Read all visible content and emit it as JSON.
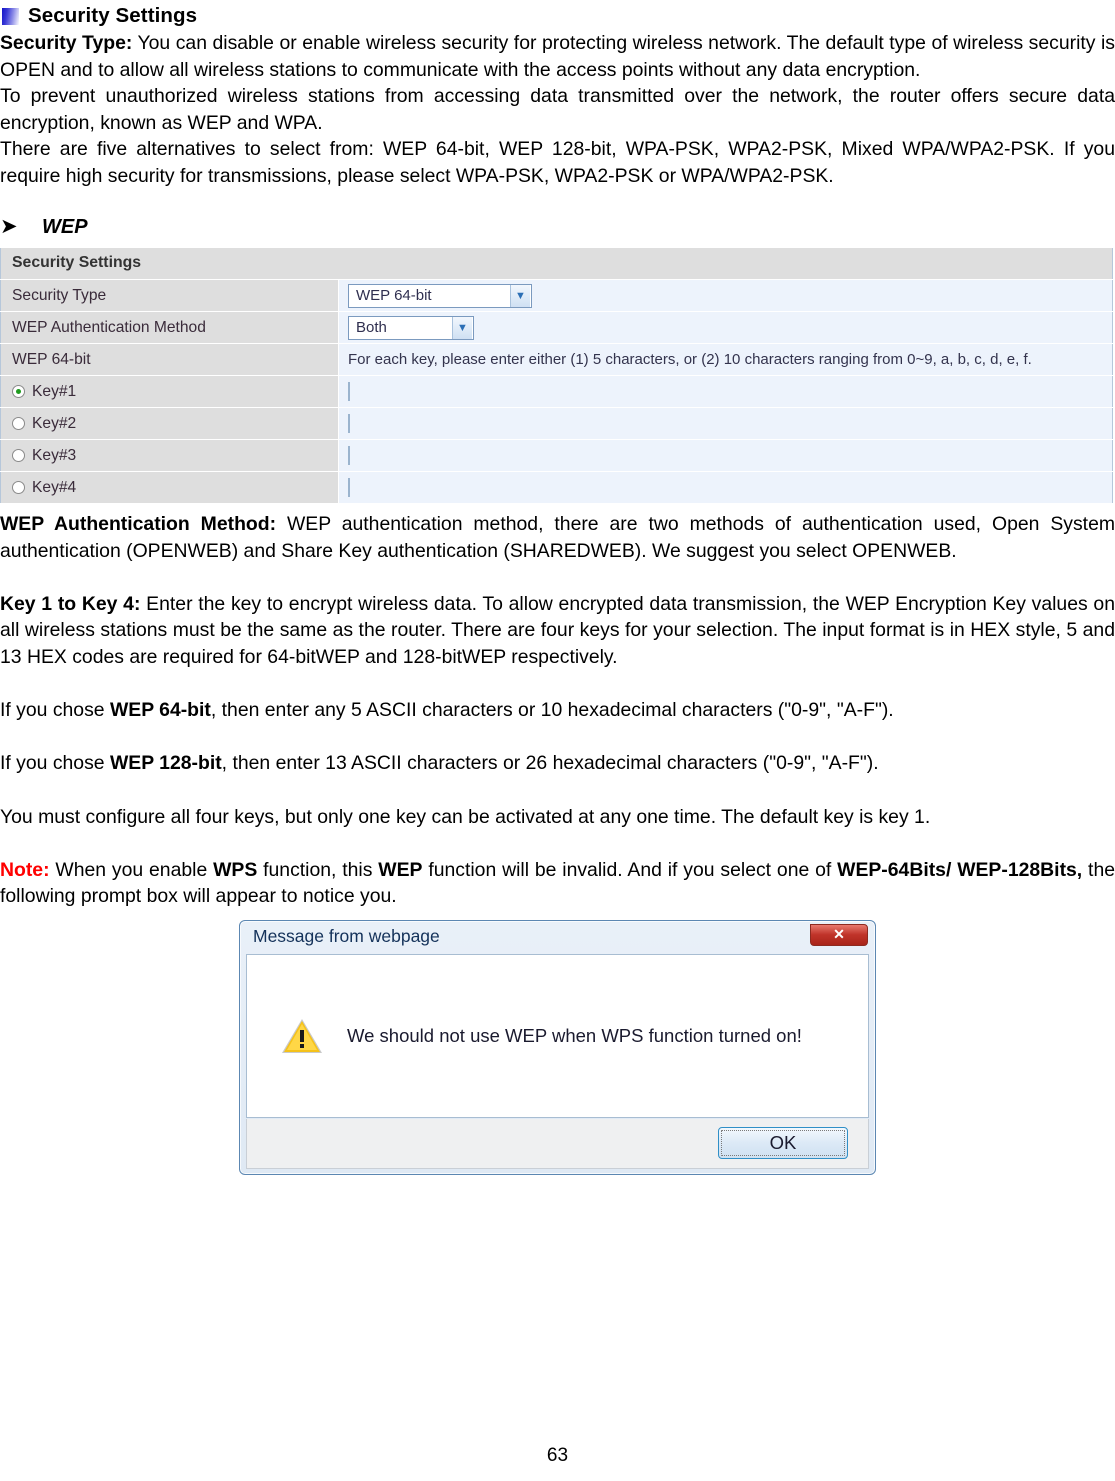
{
  "heading": {
    "title": "Security Settings",
    "bullet_icon": "blue-square-bullet-icon"
  },
  "paragraphs": {
    "security_type_label": "Security Type:",
    "security_type_body": " You can disable or enable wireless security for protecting wireless network. The default type of wireless security is OPEN and to allow all wireless stations to communicate with the access points without any data encryption.",
    "prevent_body": "To prevent unauthorized wireless stations from accessing data transmitted over the network, the router offers secure data encryption, known as WEP and WPA.",
    "alternatives_body": "There are five alternatives to select from: WEP 64-bit, WEP 128-bit, WPA-PSK, WPA2-PSK, Mixed WPA/WPA2-PSK. If you require high security for transmissions, please select WPA-PSK, WPA2-PSK or WPA/WPA2-PSK.",
    "wep_auth_label": "WEP Authentication Method:",
    "wep_auth_body": " WEP authentication method, there are two methods of authentication used, Open System authentication (OPENWEB) and Share Key authentication (SHAREDWEB). We suggest you select OPENWEB.",
    "key1to4_label": "Key 1 to Key 4:",
    "key1to4_body": " Enter the key to encrypt wireless data. To allow encrypted data transmission, the WEP Encryption Key values on all wireless stations must be the same as the router. There are four keys for your selection. The input format is in HEX style, 5 and 13 HEX codes are required for 64-bitWEP and 128-bitWEP respectively.",
    "chose64_pre": "If you chose ",
    "chose64_bold": "WEP 64-bit",
    "chose64_post": ", then enter any 5 ASCII characters or 10 hexadecimal characters (\"0-9\", \"A-F\").",
    "chose128_pre": "If you chose ",
    "chose128_bold": "WEP 128-bit",
    "chose128_post": ", then enter 13 ASCII characters or 26 hexadecimal characters (\"0-9\", \"A-F\").",
    "fourkeys_body": "You must configure all four keys, but only one key can be activated at any one time. The default key is key 1.",
    "note_label": "Note:",
    "note_p1": " When you enable ",
    "note_b1": "WPS",
    "note_p2": " function, this ",
    "note_b2": "WEP",
    "note_p3": " function will be invalid. And if you select one of ",
    "note_b3": "WEP-64Bits/ WEP-128Bits,",
    "note_p4": " the following prompt box will appear to notice you."
  },
  "subheading": {
    "arrow_icon": "chevron-right-arrow-icon",
    "label": "WEP"
  },
  "settings_table": {
    "header": "Security Settings",
    "rows": [
      {
        "label": "Security Type",
        "type": "select",
        "value": "WEP 64-bit"
      },
      {
        "label": "WEP Authentication Method",
        "type": "select",
        "value": "Both"
      },
      {
        "label": "WEP 64-bit",
        "type": "hint",
        "value": "For each key, please enter either (1) 5 characters, or (2) 10 characters ranging from 0~9, a, b, c, d, e, f."
      },
      {
        "label": "Key#1",
        "type": "key",
        "value": "",
        "selected": true
      },
      {
        "label": "Key#2",
        "type": "key",
        "value": "",
        "selected": false
      },
      {
        "label": "Key#3",
        "type": "key",
        "value": "",
        "selected": false
      },
      {
        "label": "Key#4",
        "type": "key",
        "value": "",
        "selected": false
      }
    ]
  },
  "dialog": {
    "title": "Message from webpage",
    "close_label": "✕",
    "close_icon": "close-x-icon",
    "warning_icon": "warning-triangle-icon",
    "message": "We should not use WEP when WPS function turned on!",
    "ok_label": "OK"
  },
  "footer": {
    "page_number": "63"
  },
  "colors": {
    "note_red": "#ff0000",
    "bullet_blue": "#1414c8",
    "table_label_bg": "#dedede",
    "table_value_bg": "#edf3fc",
    "dialog_border": "#5c87b2"
  }
}
